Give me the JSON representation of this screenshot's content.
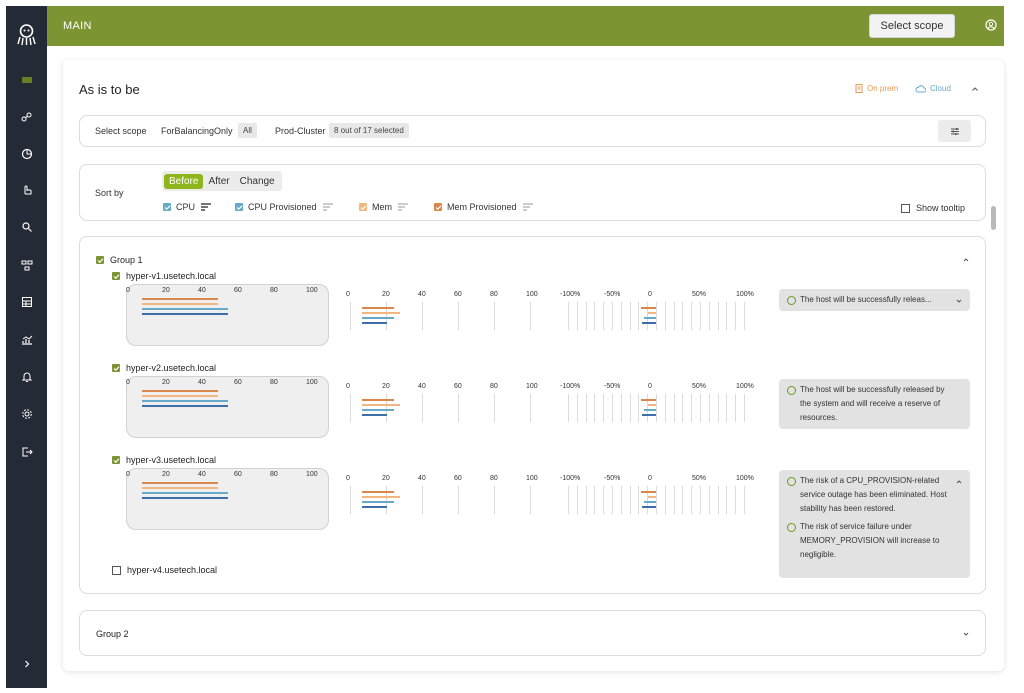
{
  "app": {
    "section_title": "MAIN",
    "select_scope_label": "Select scope"
  },
  "colors": {
    "accent": "#7c9431",
    "active": "#8fb51d",
    "sidebar": "#252b36",
    "cpu": "#66a9c9",
    "cpu_prov": "#3f6fa8",
    "mem": "#f2b680",
    "mem_prov": "#d9874a"
  },
  "sidebar": {
    "items": [
      "layers-icon",
      "nodes-icon",
      "pie-icon",
      "hand-icon",
      "search-icon",
      "network-icon",
      "table-icon",
      "analytics-icon",
      "bell-icon",
      "gear-icon",
      "logout-icon"
    ],
    "expand_icon": "chevron-right-icon"
  },
  "card": {
    "title": "As is to be",
    "legend_onprem": "On prem",
    "legend_cloud": "Cloud"
  },
  "scope": {
    "label": "Select scope",
    "name1": "ForBalancingOnly",
    "chip1": "All",
    "name2": "Prod-Cluster",
    "chip2": "8 out of 17 selected"
  },
  "sort": {
    "label": "Sort by",
    "tabs": [
      "Before",
      "After",
      "Change"
    ],
    "active_tab": "Before",
    "metrics": [
      {
        "label": "CPU",
        "checked": true
      },
      {
        "label": "CPU Provisioned",
        "checked": true
      },
      {
        "label": "Mem",
        "checked": true
      },
      {
        "label": "Mem Provisioned",
        "checked": true
      }
    ],
    "tooltip_label": "Show tooltip"
  },
  "group1": {
    "name": "Group 1",
    "hosts": [
      {
        "name": "hyper-v1.usetech.local",
        "checked": true,
        "message": "The host will be successfully releas...",
        "expanded": false
      },
      {
        "name": "hyper-v2.usetech.local",
        "checked": true,
        "message": "The host will be successfully released by the system and will receive a reserve of resources."
      },
      {
        "name": "hyper-v3.usetech.local",
        "checked": true,
        "message": "The risk of a CPU_PROVISION-related service outage has been eliminated. Host stability has been restored.",
        "message2": "The risk of service failure under MEMORY_PROVISION will increase to negligible.",
        "expanded": true
      },
      {
        "name": "hyper-v4.usetech.local",
        "checked": false
      }
    ],
    "ticks_a": [
      "0",
      "20",
      "40",
      "60",
      "80",
      "100"
    ],
    "ticks_b": [
      "0",
      "20",
      "40",
      "60",
      "80",
      "100"
    ],
    "ticks_c": [
      "-100%",
      "-50%",
      "0",
      "50%",
      "100%"
    ]
  },
  "group2": {
    "name": "Group 2"
  },
  "chart_data": {
    "type": "bar",
    "hosts": [
      "hyper-v1.usetech.local",
      "hyper-v2.usetech.local",
      "hyper-v3.usetech.local"
    ],
    "series": [
      {
        "name": "Mem Provisioned",
        "before": [
          63,
          63,
          63
        ],
        "after": [
          18,
          18,
          18
        ],
        "change": [
          -8,
          -8,
          -8
        ]
      },
      {
        "name": "Mem",
        "before": [
          63,
          63,
          63
        ],
        "after": [
          21,
          21,
          21
        ],
        "change": [
          -4,
          -4,
          -4
        ]
      },
      {
        "name": "CPU",
        "before": [
          72,
          72,
          72
        ],
        "after": [
          18,
          18,
          18
        ],
        "change": [
          -6,
          -6,
          -6
        ]
      },
      {
        "name": "CPU Provisioned",
        "before": [
          72,
          72,
          72
        ],
        "after": [
          14,
          14,
          14
        ],
        "change": [
          -7,
          -7,
          -7
        ]
      }
    ],
    "xlim_before": [
      0,
      100
    ],
    "xlim_after": [
      0,
      100
    ],
    "xlim_change": [
      -100,
      100
    ]
  }
}
